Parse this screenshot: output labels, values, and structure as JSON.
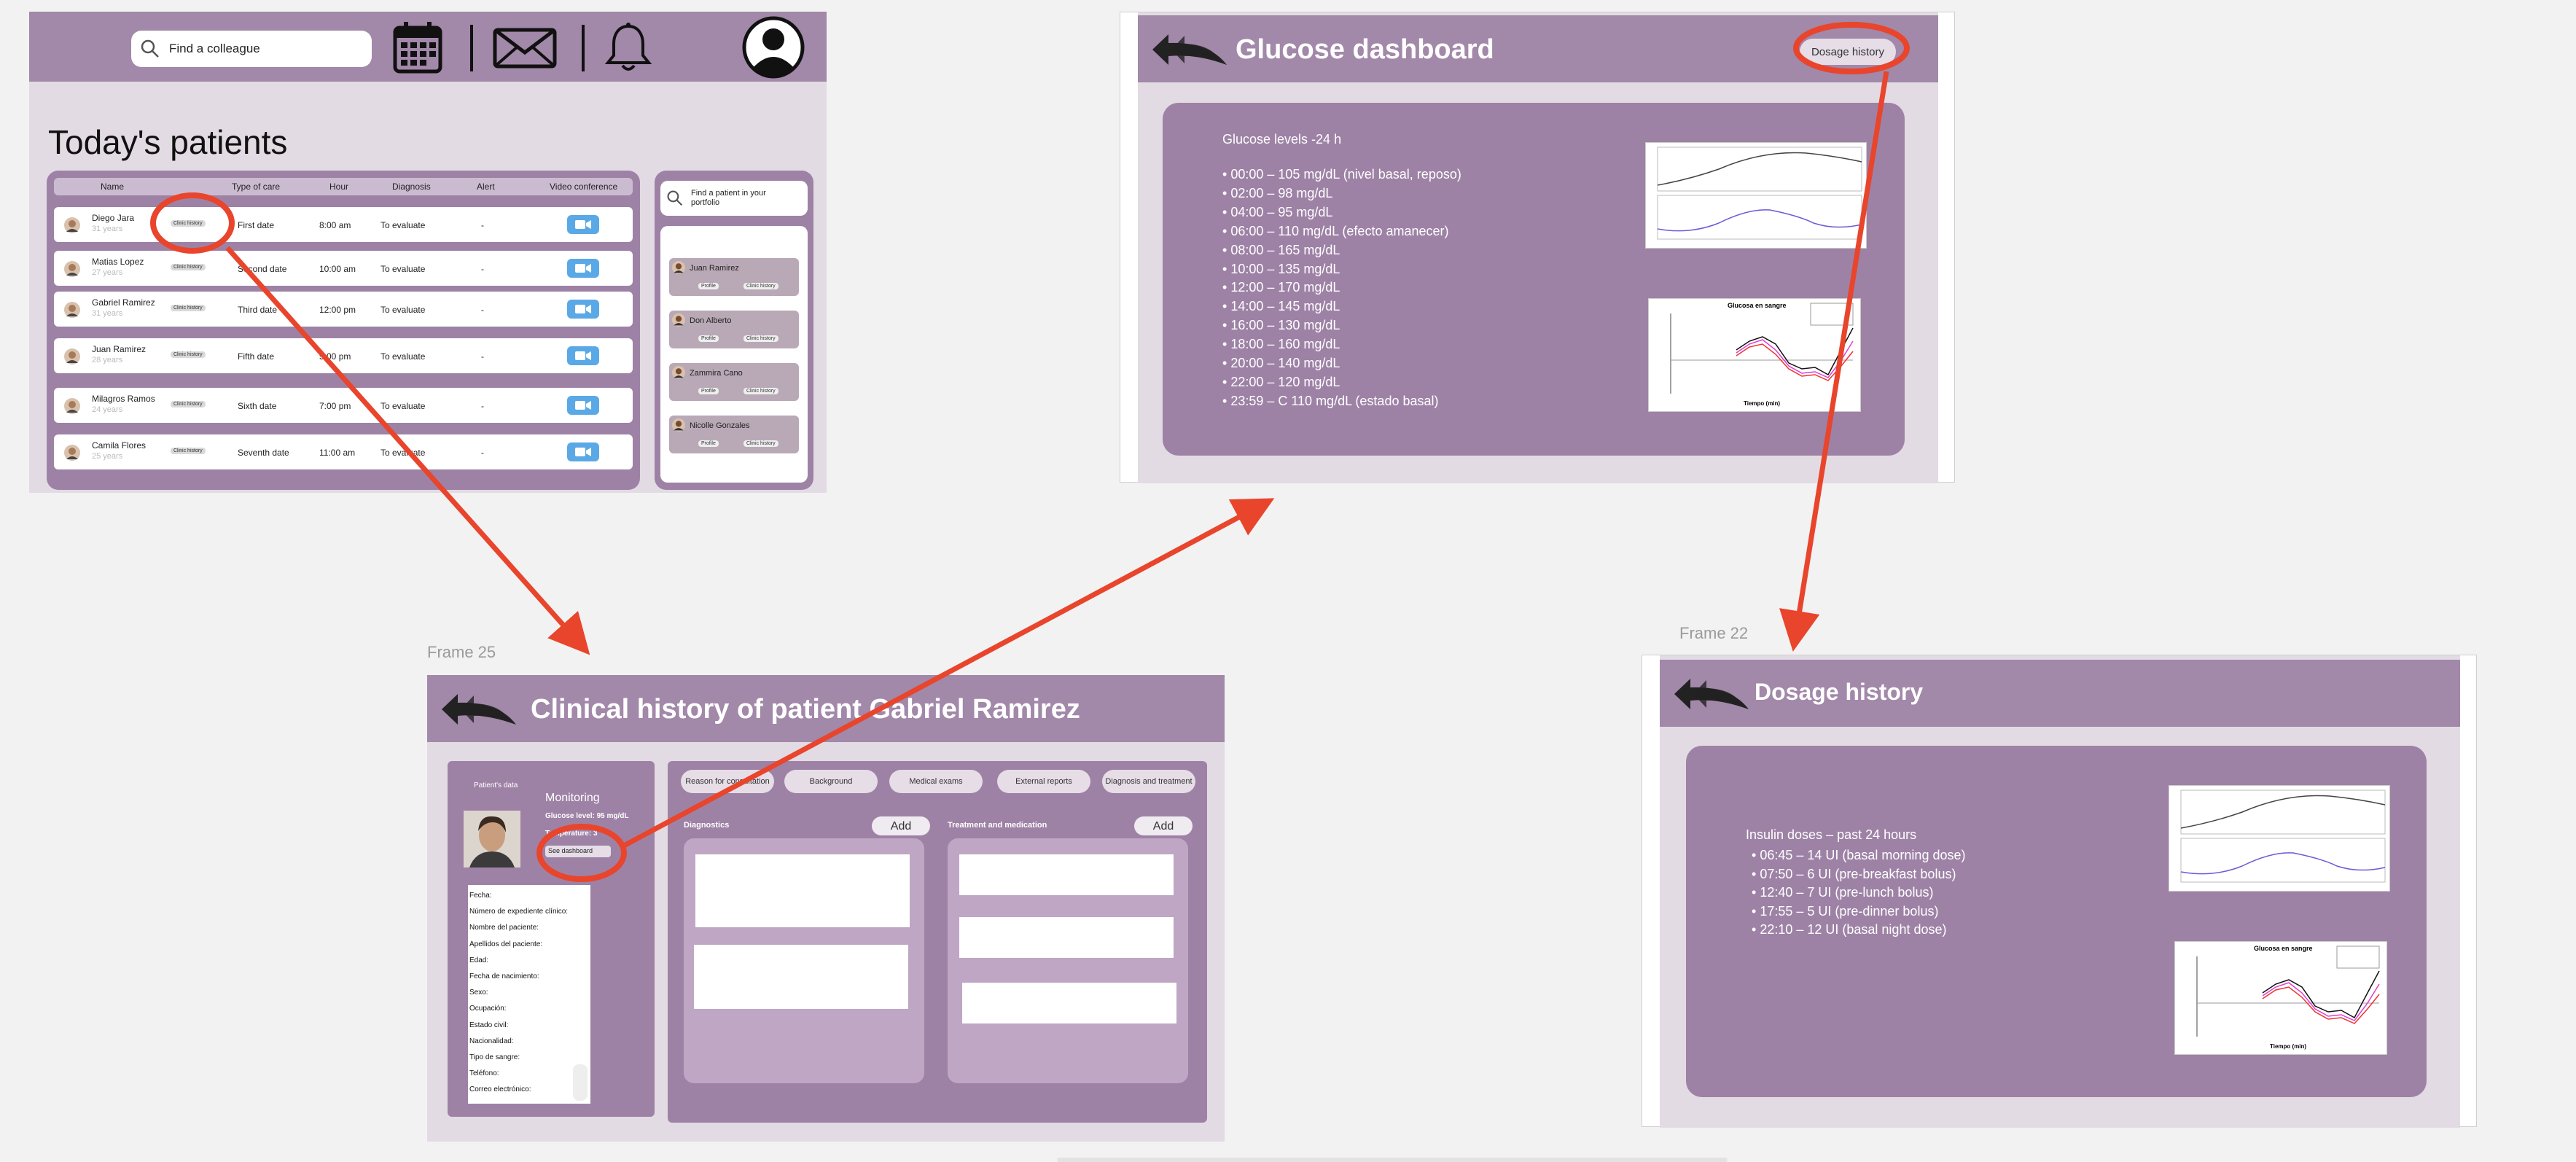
{
  "frame1": {
    "search_placeholder": "Find a colleague",
    "title": "Today's patients",
    "columns": [
      "Name",
      "Type of care",
      "Hour",
      "Diagnosis",
      "Alert",
      "Video conference"
    ],
    "clinic_badge": "Clinic history",
    "patients": [
      {
        "name": "Diego Jara",
        "age": "31 years",
        "care": "First date",
        "hour": "8:00 am",
        "diagnosis": "To evaluate",
        "alert": "-"
      },
      {
        "name": "Matias Lopez",
        "age": "27 years",
        "care": "Second date",
        "hour": "10:00 am",
        "diagnosis": "To evaluate",
        "alert": "-"
      },
      {
        "name": "Gabriel Ramirez",
        "age": "31 years",
        "care": "Third date",
        "hour": "12:00 pm",
        "diagnosis": "To evaluate",
        "alert": "-"
      },
      {
        "name": "Juan Ramirez",
        "age": "28 years",
        "care": "Fifth date",
        "hour": "5:00 pm",
        "diagnosis": "To evaluate",
        "alert": "-"
      },
      {
        "name": "Milagros Ramos",
        "age": "24 years",
        "care": "Sixth date",
        "hour": "7:00 pm",
        "diagnosis": "To evaluate",
        "alert": "-"
      },
      {
        "name": "Camila Flores",
        "age": "25 years",
        "care": "Seventh date",
        "hour": "11:00 am",
        "diagnosis": "To evaluate",
        "alert": "-"
      }
    ],
    "portfolio_search": "Find a patient in your portfolio",
    "portfolio": [
      {
        "name": "Juan Ramirez"
      },
      {
        "name": "Don Alberto"
      },
      {
        "name": "Zammira Cano"
      },
      {
        "name": "Nicolle Gonzales"
      }
    ],
    "profile_btn": "Profile",
    "clinic_btn": "Clinic history"
  },
  "frame2": {
    "title": "Glucose dashboard",
    "dosage_btn": "Dosage history",
    "levels_title": "Glucose levels -24 h",
    "levels": [
      "00:00 – 105 mg/dL (nivel basal, reposo)",
      "02:00 – 98 mg/dL",
      "04:00 – 95 mg/dL",
      "06:00 – 110 mg/dL (efecto amanecer)",
      "08:00 – 165 mg/dL",
      "10:00 – 135 mg/dL",
      "12:00 – 170 mg/dL",
      "14:00 – 145 mg/dL",
      "16:00 – 130 mg/dL",
      "18:00 – 160 mg/dL",
      "20:00 – 140 mg/dL",
      "22:00 – 120 mg/dL",
      "23:59 – C 110 mg/dL (estado basal)"
    ],
    "chart_title": "Glucosa en sangre",
    "chart_xlabel": "Tiempo (min)"
  },
  "frame3": {
    "frame_label": "Frame 25",
    "title": "Clinical history of patient Gabriel Ramirez",
    "patient_data": "Patient's data",
    "monitoring": "Monitoring",
    "glucose_level": "Glucose level: 95 mg/dL",
    "temperature": "Temperature: 3",
    "see_dashboard": "See dashboard",
    "fields": [
      "Fecha:",
      "Número de expediente clínico:",
      "Nombre del paciente:",
      "Apellidos del paciente:",
      "Edad:",
      "Fecha de nacimiento:",
      "Sexo:",
      "Ocupación:",
      "Estado civil:",
      "Nacionalidad:",
      "Tipo de sangre:",
      "Teléfono:",
      "Correo electrónico:"
    ],
    "tabs": [
      "Reason for consultation",
      "Background",
      "Medical exams",
      "External reports",
      "Diagnosis and treatment"
    ],
    "diagnostics": "Diagnostics",
    "treatment": "Treatment and medication",
    "add": "Add"
  },
  "frame4": {
    "frame_label": "Frame 22",
    "title": "Dosage history",
    "doses_title": "Insulin doses – past 24 hours",
    "doses": [
      "06:45 – 14 UI (basal morning dose)",
      "07:50 – 6 UI (pre-breakfast bolus)",
      "12:40 – 7 UI (pre-lunch bolus)",
      "17:55 – 5 UI (pre-dinner bolus)",
      "22:10 – 12 UI (basal night dose)"
    ],
    "chart_title": "Glucosa en sangre",
    "chart_xlabel": "Tiempo (min)"
  },
  "colors": {
    "accent": "#a288a9",
    "panel": "#9e82a6",
    "arrow": "#e8452c",
    "video": "#5aa9e6"
  }
}
